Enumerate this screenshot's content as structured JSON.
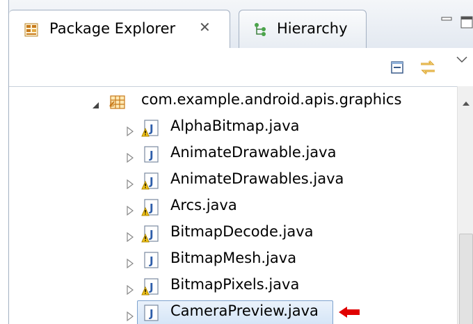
{
  "tabs": [
    {
      "label": "Package Explorer",
      "active": true,
      "icon": "package-explorer-icon"
    },
    {
      "label": "Hierarchy",
      "active": false,
      "icon": "hierarchy-icon"
    }
  ],
  "tree": {
    "package": {
      "label": "com.example.android.apis.graphics",
      "expanded": true
    },
    "files": [
      {
        "label": "AlphaBitmap.java",
        "warning": true
      },
      {
        "label": "AnimateDrawable.java",
        "warning": false
      },
      {
        "label": "AnimateDrawables.java",
        "warning": true
      },
      {
        "label": "Arcs.java",
        "warning": true
      },
      {
        "label": "BitmapDecode.java",
        "warning": true
      },
      {
        "label": "BitmapMesh.java",
        "warning": false
      },
      {
        "label": "BitmapPixels.java",
        "warning": true
      },
      {
        "label": "CameraPreview.java",
        "warning": false,
        "selected": true
      }
    ]
  },
  "colors": {
    "java_icon_blue": "#2e5eaa",
    "warning_yellow": "#f5c518",
    "package_orange": "#c87a1a",
    "annotation_arrow": "#e00000"
  }
}
